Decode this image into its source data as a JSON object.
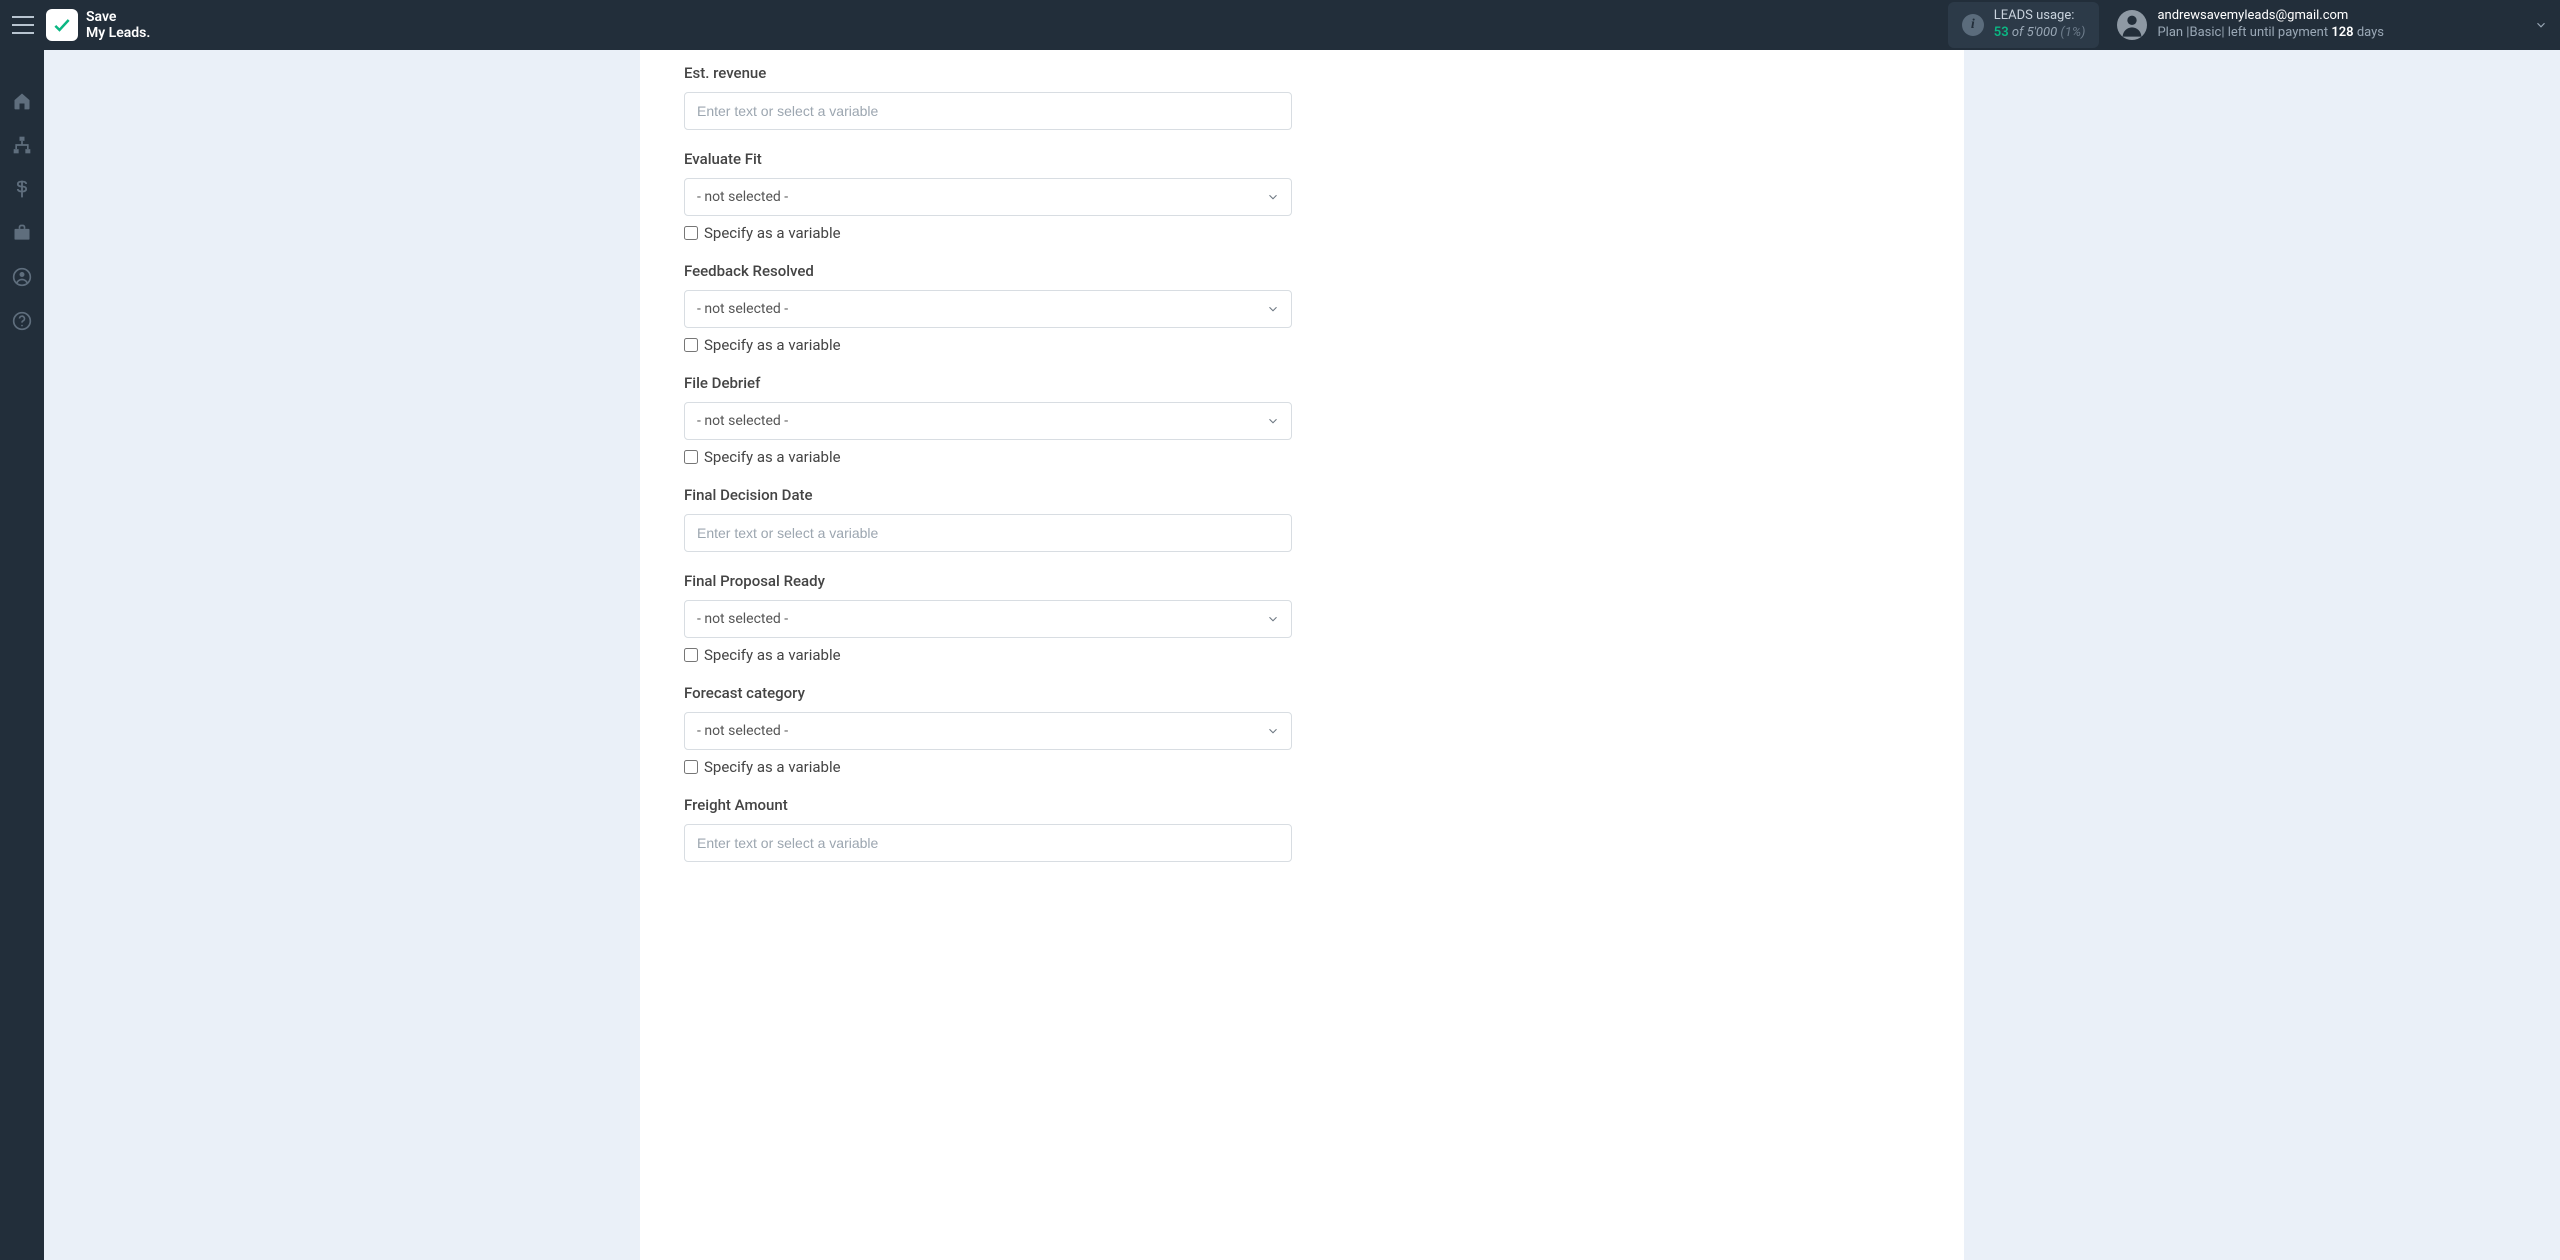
{
  "brand": {
    "line1": "Save",
    "line2": "My Leads."
  },
  "usage": {
    "label": "LEADS usage:",
    "current": "53",
    "of_word": "of",
    "max": "5'000",
    "pct": "(1%)"
  },
  "user": {
    "email": "andrewsavemyleads@gmail.com",
    "plan_prefix": "Plan |",
    "plan_name": "Basic",
    "plan_mid": "| left until payment ",
    "days": "128",
    "days_suffix": " days"
  },
  "sidebar_icons": [
    "home",
    "sitemap",
    "dollar",
    "briefcase",
    "user",
    "question"
  ],
  "common": {
    "text_placeholder": "Enter text or select a variable",
    "not_selected": "- not selected -",
    "specify_variable": "Specify as a variable"
  },
  "fields": [
    {
      "key": "est_revenue",
      "label": "Est. revenue",
      "type": "text"
    },
    {
      "key": "evaluate_fit",
      "label": "Evaluate Fit",
      "type": "select"
    },
    {
      "key": "feedback_resolved",
      "label": "Feedback Resolved",
      "type": "select"
    },
    {
      "key": "file_debrief",
      "label": "File Debrief",
      "type": "select"
    },
    {
      "key": "final_decision",
      "label": "Final Decision Date",
      "type": "text"
    },
    {
      "key": "final_proposal",
      "label": "Final Proposal Ready",
      "type": "select"
    },
    {
      "key": "forecast_cat",
      "label": "Forecast category",
      "type": "select"
    },
    {
      "key": "freight_amount",
      "label": "Freight Amount",
      "type": "text"
    }
  ]
}
